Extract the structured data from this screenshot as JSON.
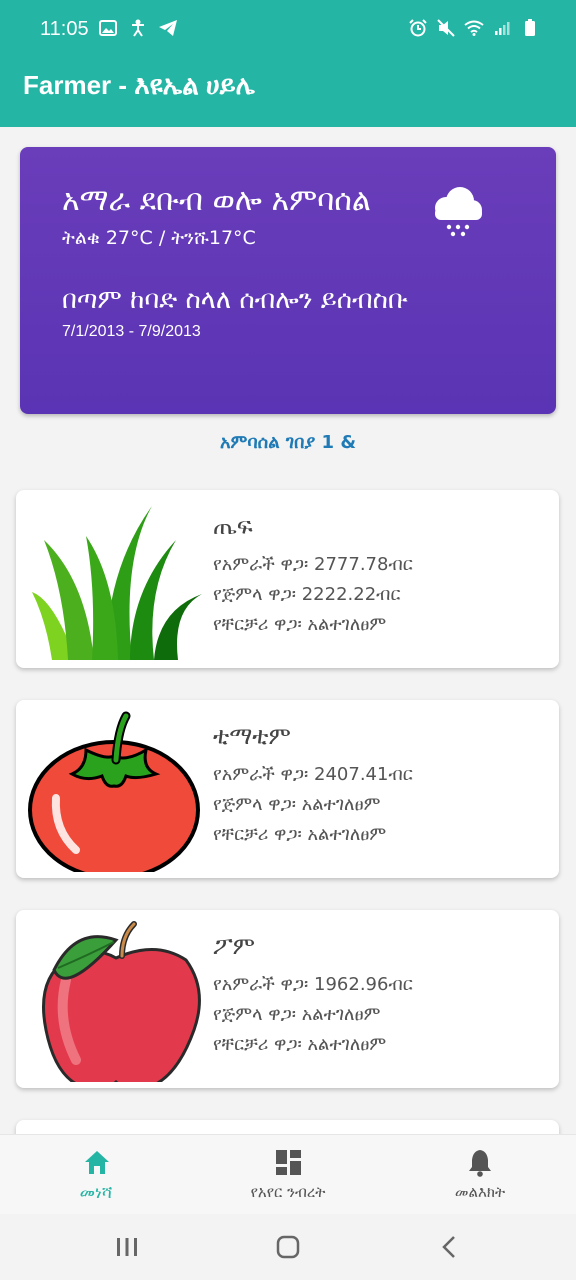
{
  "status_bar": {
    "time": "11:05",
    "left_icons": [
      "image-icon",
      "accessibility-icon",
      "telegram-icon"
    ],
    "right_icons": [
      "alarm-icon",
      "mute-icon",
      "wifi-icon",
      "signal-icon",
      "battery-icon"
    ]
  },
  "app_bar": {
    "title": "Farmer -  እዩኤል ሀይሌ"
  },
  "weather": {
    "location": "አማራ ደቡብ ወሎ አምባሰል",
    "temperature": "ትልቁ 27°C / ትንሹ17°C",
    "advice": "በጣም ከባድ ስላለ ሰብሎን ይሰብስቡ",
    "date_range": "7/1/2013 - 7/9/2013",
    "icon": "cloud-snow-icon",
    "colors": {
      "card": "#5f37b6"
    }
  },
  "season_label": "አምባሰል ገበያ 1 &",
  "crops": [
    {
      "icon": "grass-icon",
      "name": "ጤፍ",
      "line1": "የአምራች ዋጋ፡ 2777.78ብር",
      "line2": "የጅምላ ዋጋ፡ 2222.22ብር",
      "line3": "የቸርቻሪ ዋጋ፡ አልተገለፀም"
    },
    {
      "icon": "tomato-icon",
      "name": "ቲማቲም",
      "line1": "የአምራች ዋጋ፡ 2407.41ብር",
      "line2": "የጅምላ ዋጋ፡ አልተገለፀም",
      "line3": "የቸርቻሪ ዋጋ፡ አልተገለፀም"
    },
    {
      "icon": "apple-icon",
      "name": "ፖም",
      "line1": "የአምራች ዋጋ፡ 1962.96ብር",
      "line2": "የጅምላ ዋጋ፡ አልተገለፀም",
      "line3": "የቸርቻሪ ዋጋ፡ አልተገለፀም"
    }
  ],
  "bottom_nav": {
    "home": "መነሻ",
    "weather": "የአየር ንብረት",
    "messages": "መልእክት",
    "active_color": "#25b5a5"
  },
  "theme": {
    "primary": "#25b5a5",
    "season_text": "#1f7ab5"
  }
}
